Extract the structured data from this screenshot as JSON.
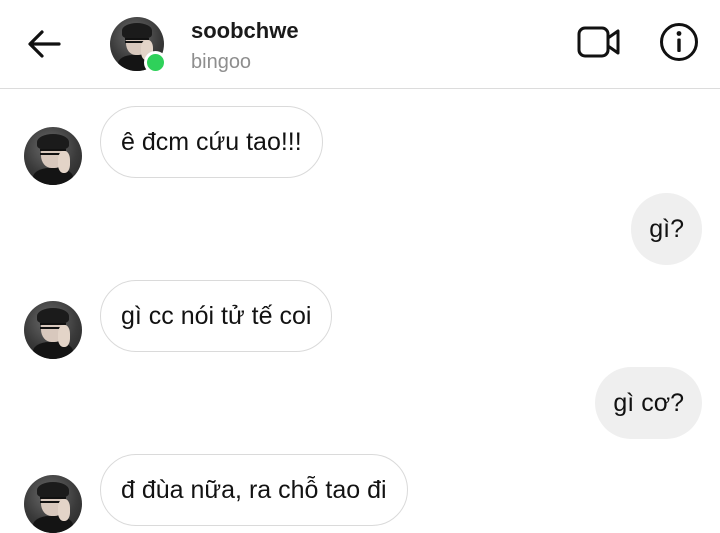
{
  "header": {
    "username": "soobchwe",
    "subtitle": "bingoo",
    "icons": [
      "back-arrow-icon",
      "video-call-icon",
      "info-icon"
    ],
    "online_color": "#2fd15a"
  },
  "messages": [
    {
      "sender": "other",
      "text": "ê đcm cứu tao!!!"
    },
    {
      "sender": "me",
      "text": "gì?"
    },
    {
      "sender": "other",
      "text": "gì cc nói tử tế coi"
    },
    {
      "sender": "me",
      "text": "gì cơ?"
    },
    {
      "sender": "other",
      "text": "đ đùa nữa, ra chỗ tao đi"
    }
  ],
  "colors": {
    "outgoing_bubble": "#efefef",
    "incoming_border": "#dadada",
    "subtitle_text": "#8e8e8e"
  }
}
